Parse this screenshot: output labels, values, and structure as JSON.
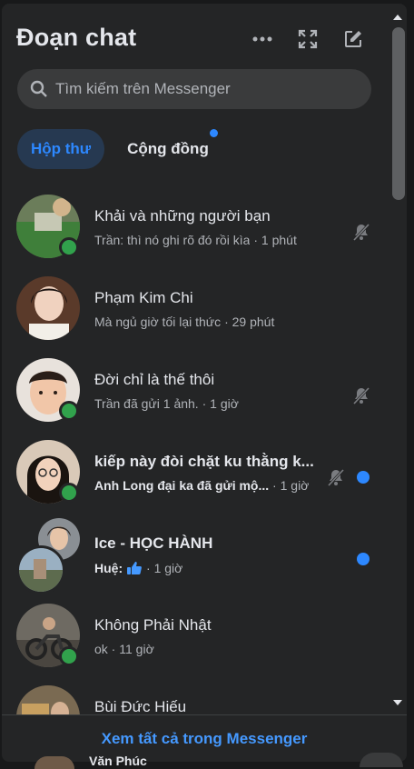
{
  "header": {
    "title": "Đoạn chat"
  },
  "search": {
    "placeholder": "Tìm kiếm trên Messenger"
  },
  "tabs": [
    {
      "label": "Hộp thư",
      "active": true
    },
    {
      "label": "Cộng đồng",
      "active": false,
      "has_badge": true
    }
  ],
  "conversations": [
    {
      "name": "Khải và những người bạn",
      "preview": "Trần: thì nó ghi rõ đó rồi kìa",
      "time": "1 phút",
      "muted": true,
      "online": true,
      "unread": false
    },
    {
      "name": "Phạm Kim Chi",
      "preview": "Mà ngủ giờ tối lại thức",
      "time": "29 phút",
      "muted": false,
      "online": false,
      "unread": false
    },
    {
      "name": "Đời chỉ là thế thôi",
      "preview": "Trần đã gửi 1 ảnh.",
      "time": "1 giờ",
      "muted": true,
      "online": true,
      "unread": false
    },
    {
      "name": "kiếp này đòi chặt ku thằng k...",
      "preview": "Anh Long đại ka đã gửi mộ...",
      "time": "1 giờ",
      "muted": true,
      "online": true,
      "unread": true
    },
    {
      "name": "Ice - HỌC HÀNH",
      "preview": "Huệ:",
      "time": "1 giờ",
      "muted": false,
      "online": false,
      "unread": true
    },
    {
      "name": "Không Phải Nhật",
      "preview": "ok",
      "time": "11 giờ",
      "muted": false,
      "online": true,
      "unread": false
    },
    {
      "name": "Bùi Đức Hiếu",
      "preview": "",
      "time": "",
      "muted": false,
      "online": false,
      "unread": false
    }
  ],
  "footer": {
    "link": "Xem tất cả trong Messenger",
    "peek_name": "Văn Phúc"
  },
  "colors": {
    "accent": "#2d88ff",
    "online": "#31a24c",
    "panel": "#242526"
  }
}
